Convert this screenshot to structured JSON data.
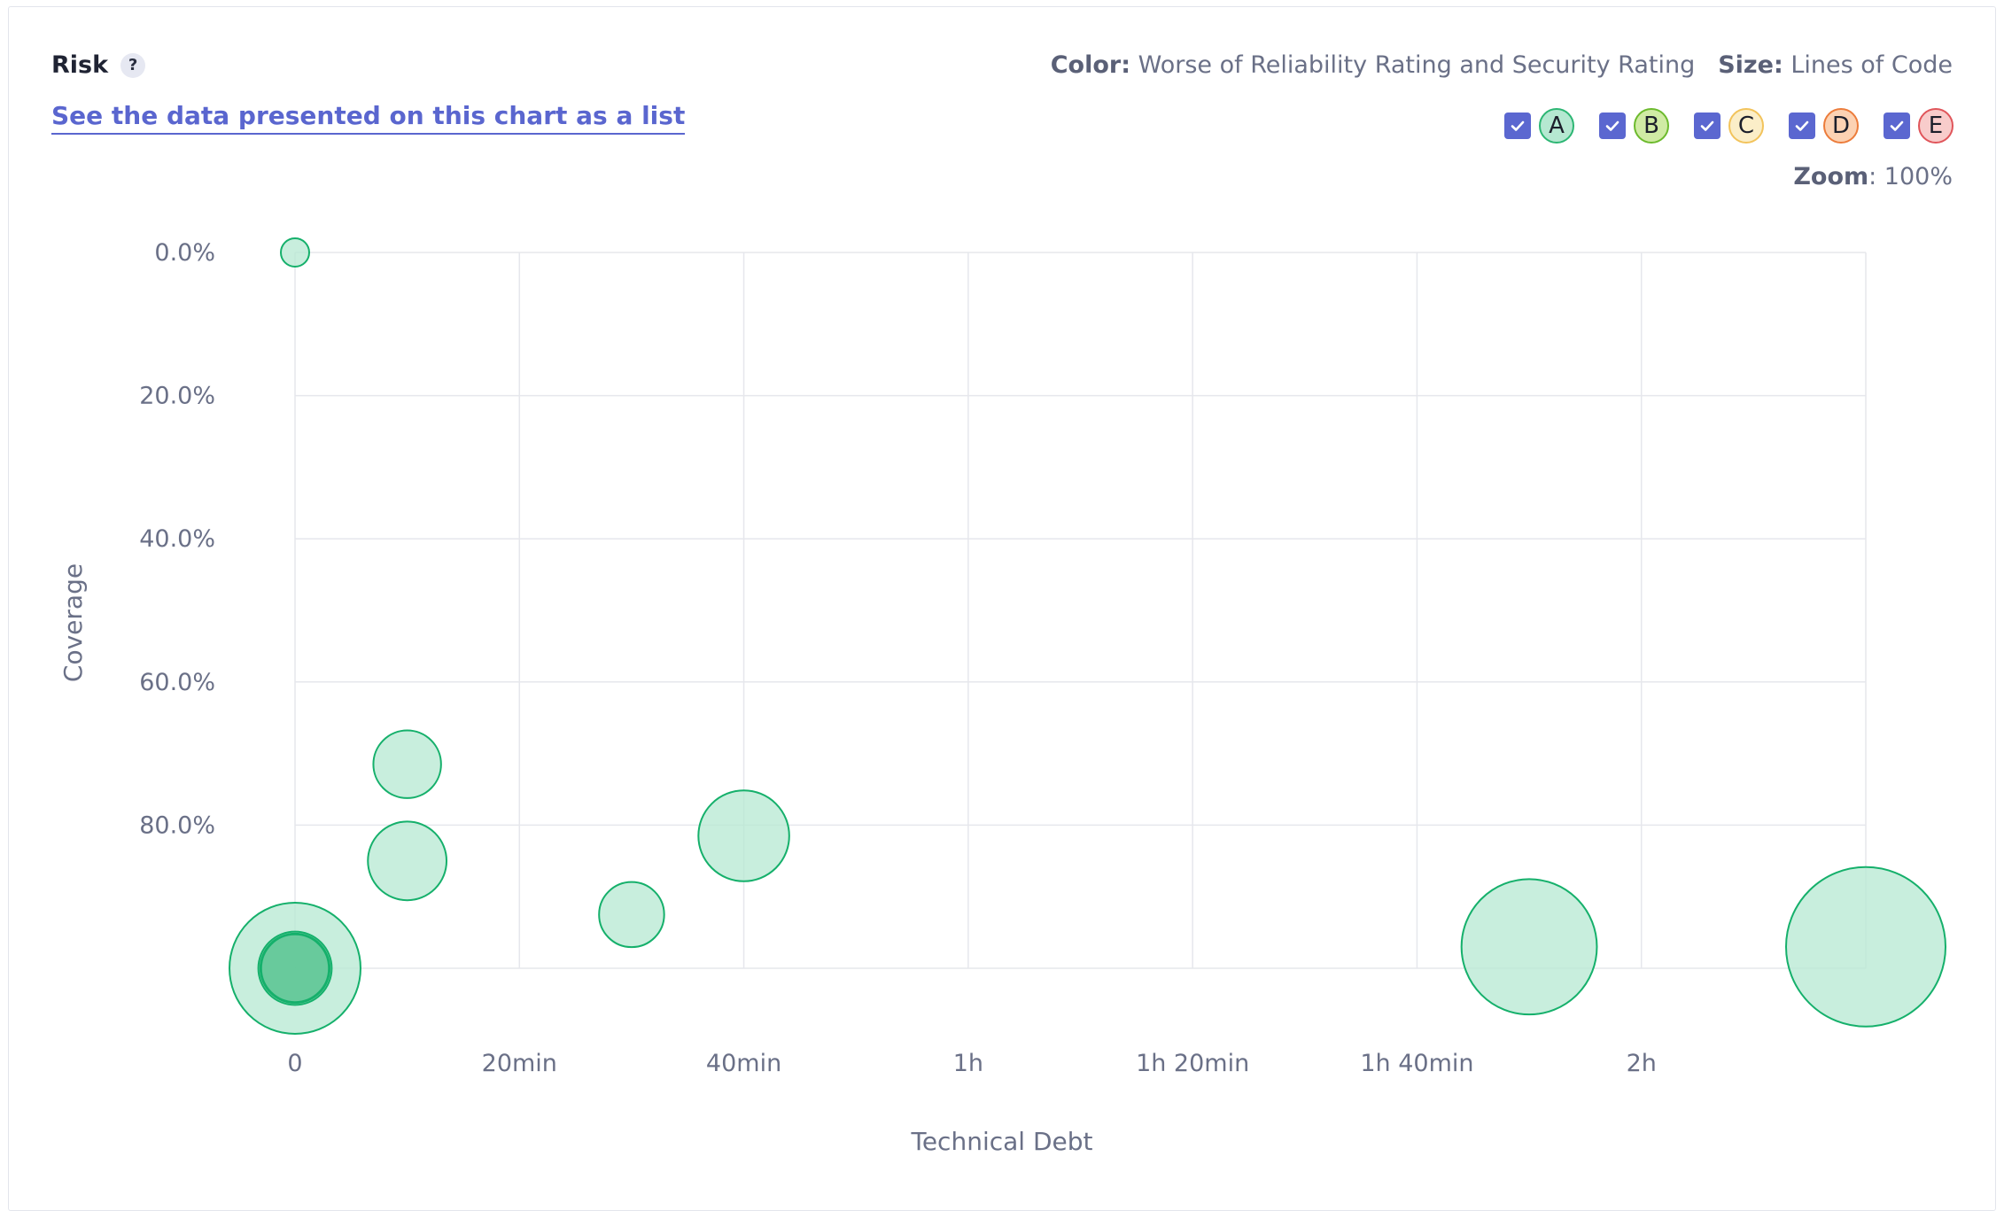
{
  "header": {
    "title": "Risk",
    "help_icon": "?",
    "list_link": "See the data presented on this chart as a list",
    "color_label": "Color:",
    "color_value": "Worse of Reliability Rating and Security Rating",
    "size_label": "Size:",
    "size_value": "Lines of Code",
    "zoom_label": "Zoom",
    "zoom_value": ": 100%"
  },
  "legend": [
    {
      "label": "A",
      "checked": true,
      "fill": "#b5e8d1",
      "border": "#2cb673"
    },
    {
      "label": "B",
      "checked": true,
      "fill": "#d0eba4",
      "border": "#6cba2d"
    },
    {
      "label": "C",
      "checked": true,
      "fill": "#fbeec8",
      "border": "#f2c35b"
    },
    {
      "label": "D",
      "checked": true,
      "fill": "#fcd2b3",
      "border": "#ec7c3b"
    },
    {
      "label": "E",
      "checked": true,
      "fill": "#f8cccb",
      "border": "#e0555a"
    }
  ],
  "colors": {
    "accent": "#5b67d0",
    "bubble_fill": "#b5e8d1",
    "bubble_stroke": "#15b06b",
    "bubble_dense_fill": "#5ec796"
  },
  "chart_data": {
    "type": "scatter",
    "xlabel": "Technical Debt",
    "ylabel": "Coverage",
    "x_unit": "minutes",
    "y_unit": "percent",
    "xlim": [
      0,
      140
    ],
    "ylim": [
      0,
      100
    ],
    "y_inverted": true,
    "x_ticks": [
      {
        "value": 0,
        "label": "0"
      },
      {
        "value": 20,
        "label": "20min"
      },
      {
        "value": 40,
        "label": "40min"
      },
      {
        "value": 60,
        "label": "1h"
      },
      {
        "value": 80,
        "label": "1h 20min"
      },
      {
        "value": 100,
        "label": "1h 40min"
      },
      {
        "value": 120,
        "label": "2h"
      }
    ],
    "y_ticks": [
      {
        "value": 0,
        "label": "0.0%"
      },
      {
        "value": 20,
        "label": "20.0%"
      },
      {
        "value": 40,
        "label": "40.0%"
      },
      {
        "value": 60,
        "label": "60.0%"
      },
      {
        "value": 80,
        "label": "80.0%"
      }
    ],
    "grid": true,
    "size_metric": "Lines of Code",
    "color_metric": "Worse of Reliability Rating and Security Rating",
    "points": [
      {
        "x": 0,
        "y": 0,
        "size": 5,
        "rating": "A"
      },
      {
        "x": 10,
        "y": 71.5,
        "size": 40,
        "rating": "A"
      },
      {
        "x": 10,
        "y": 85,
        "size": 54,
        "rating": "A"
      },
      {
        "x": 30,
        "y": 92.5,
        "size": 37,
        "rating": "A"
      },
      {
        "x": 40,
        "y": 81.5,
        "size": 72,
        "rating": "A"
      },
      {
        "x": 0,
        "y": 100,
        "size": 150,
        "rating": "A"
      },
      {
        "x": 0,
        "y": 100,
        "size": 47,
        "rating": "A"
      },
      {
        "x": 0,
        "y": 100,
        "size": 42,
        "rating": "A"
      },
      {
        "x": 0,
        "y": 100,
        "size": 40,
        "rating": "A"
      },
      {
        "x": 110,
        "y": 97,
        "size": 160,
        "rating": "A"
      },
      {
        "x": 140,
        "y": 97,
        "size": 222,
        "rating": "A"
      }
    ]
  }
}
